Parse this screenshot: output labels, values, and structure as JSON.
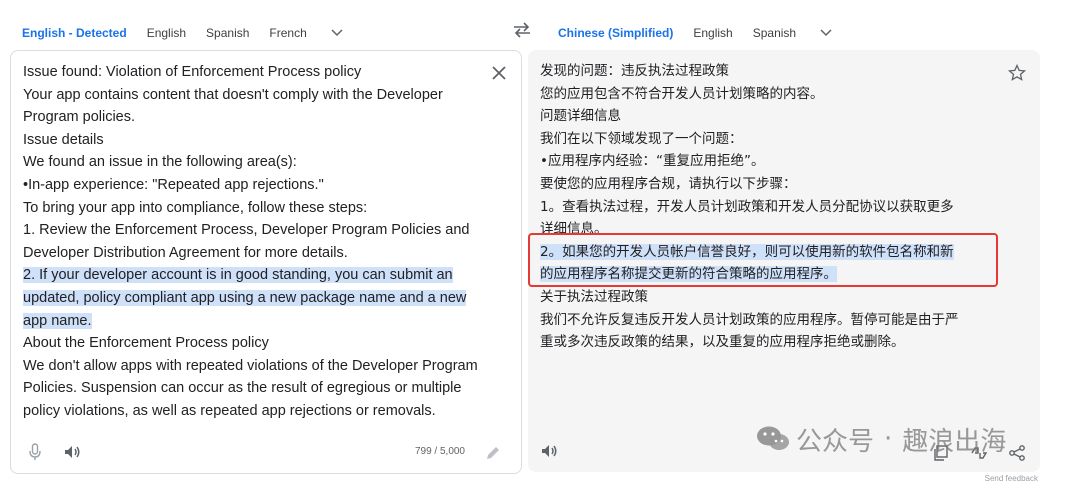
{
  "source_tabs": [
    "English - Detected",
    "English",
    "Spanish",
    "French"
  ],
  "target_tabs": [
    "Chinese (Simplified)",
    "English",
    "Spanish"
  ],
  "source_text": [
    "Issue found: Violation of Enforcement Process policy",
    "Your app contains content that doesn't comply with the Developer",
    "Program policies.",
    "Issue details",
    "We found an issue in the following area(s):",
    "•In-app experience: \"Repeated app rejections.\"",
    "To bring your app into compliance, follow these steps:",
    "1. Review the Enforcement Process, Developer Program Policies and",
    "Developer Distribution Agreement for more details.",
    "2. If your developer account is in good standing, you can submit an",
    "updated, policy compliant app using a new package name and a new",
    "app name.",
    "About the Enforcement Process policy",
    "We don't allow apps with repeated violations of the Developer Program",
    "Policies. Suspension can occur as the result of egregious or multiple",
    "policy violations, as well as repeated app rejections or removals."
  ],
  "target_text": [
    "发现的问题：违反执法过程政策",
    "您的应用包含不符合开发人员计划策略的内容。",
    "问题详细信息",
    "我们在以下领域发现了一个问题：",
    "•应用程序内经验：“重复应用拒绝”。",
    "要使您的应用程序合规，请执行以下步骤：",
    "1。查看执法过程，开发人员计划政策和开发人员分配协议以获取更多",
    "详细信息。",
    "2。如果您的开发人员帐户信誉良好，则可以使用新的软件包名称和新",
    "的应用程序名称提交更新的符合策略的应用程序。",
    "关于执法过程政策",
    "我们不允许反复违反开发人员计划政策的应用程序。暂停可能是由于严",
    "重或多次违反政策的结果，以及重复的应用程序拒绝或删除。"
  ],
  "char_count": "799 / 5,000",
  "watermark": {
    "part1": "公众号",
    "separator": "·",
    "part2": "趣浪出海"
  },
  "footnote": "Send feedback",
  "colors": {
    "accent": "#1a73e8",
    "highlight": "#cfe0f9",
    "box": "#e53935"
  }
}
